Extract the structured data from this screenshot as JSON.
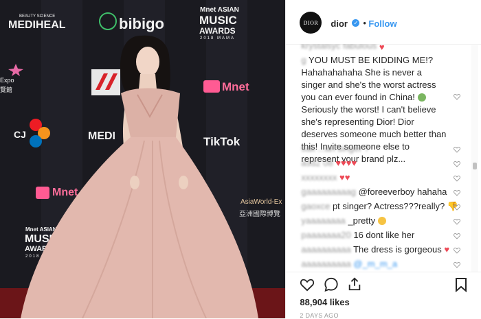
{
  "photo": {
    "logos": [
      {
        "id": "mediheal",
        "text": "MEDIHEAL",
        "sub": "BEAUTY SCIENCE"
      },
      {
        "id": "bibigo",
        "text": "bibigo"
      },
      {
        "id": "mama-top-line1",
        "text": "Mnet ASIAN"
      },
      {
        "id": "mama-top-line2",
        "text": "MUSIC"
      },
      {
        "id": "mama-top-line3",
        "text": "AWARDS"
      },
      {
        "id": "mama-top-line4",
        "text": "2018 MAMA"
      },
      {
        "id": "expo",
        "text": "Expo"
      },
      {
        "id": "expo2",
        "text": "覽館"
      },
      {
        "id": "mnet-right",
        "text": "Mnet"
      },
      {
        "id": "cj",
        "text": "CJ"
      },
      {
        "id": "medi2",
        "text": "MEDI"
      },
      {
        "id": "tiktok",
        "text": "TikTok"
      },
      {
        "id": "mnet-left",
        "text": "Mnet"
      },
      {
        "id": "asiaworld",
        "text": "AsiaWorld-Ex"
      },
      {
        "id": "asiaworld-cn",
        "text": "亞洲國際博覽"
      },
      {
        "id": "mama-bottom-line1",
        "text": "Mnet ASIAN"
      },
      {
        "id": "mama-bottom-line2",
        "text": "MUSIC"
      },
      {
        "id": "mama-bottom-line3",
        "text": "AWARDS"
      },
      {
        "id": "mama-bottom-line4",
        "text": "2018 MAMA"
      }
    ]
  },
  "header": {
    "avatar_text": "DIOR",
    "username": "dior",
    "verified_glyph": "✓",
    "separator": "•",
    "follow_label": "Follow"
  },
  "comments": [
    {
      "user": "krystalsyc",
      "text": "fabulous",
      "emoji": "heart"
    },
    {
      "user": "g",
      "text": "YOU MUST BE KIDDING ME!? Hahahahahaha She is never a singer and she's the worst actress you can ever found in China!",
      "emoji_mid": "nauseated",
      "text2": "Seriously the worst! I can't believe she's representing Dior! Dior deserves someone much better than this! Invite someone else to represent your brand plz..."
    },
    {
      "user": "s",
      "text": "...an singer ?"
    },
    {
      "user": "a",
      "text": "08",
      "hearts": 4
    },
    {
      "user": "",
      "text": "",
      "hearts": 2
    },
    {
      "user": "g",
      "text": "@foreeverboy hahaha"
    },
    {
      "user": "",
      "text": "pt singer? Actress???really?",
      "emoji": "thumbs-down"
    },
    {
      "user": "y",
      "text": "_pretty",
      "emoji": "heart-eyes"
    },
    {
      "user": "p",
      "text": "16 dont like her"
    },
    {
      "user": "",
      "text": "The dress is gorgeous",
      "emoji": "heart"
    },
    {
      "user": "",
      "text": "@_m_m_a"
    }
  ],
  "actions": {
    "like_icon": "heart-outline-icon",
    "comment_icon": "comment-bubble-icon",
    "share_icon": "share-icon",
    "save_icon": "bookmark-icon"
  },
  "likes": "88,904 likes",
  "time_ago": "2 DAYS AGO",
  "colors": {
    "accent": "#3897f0",
    "text": "#262626",
    "muted": "#999999",
    "heart": "#ed4956",
    "divider": "#efefef"
  }
}
